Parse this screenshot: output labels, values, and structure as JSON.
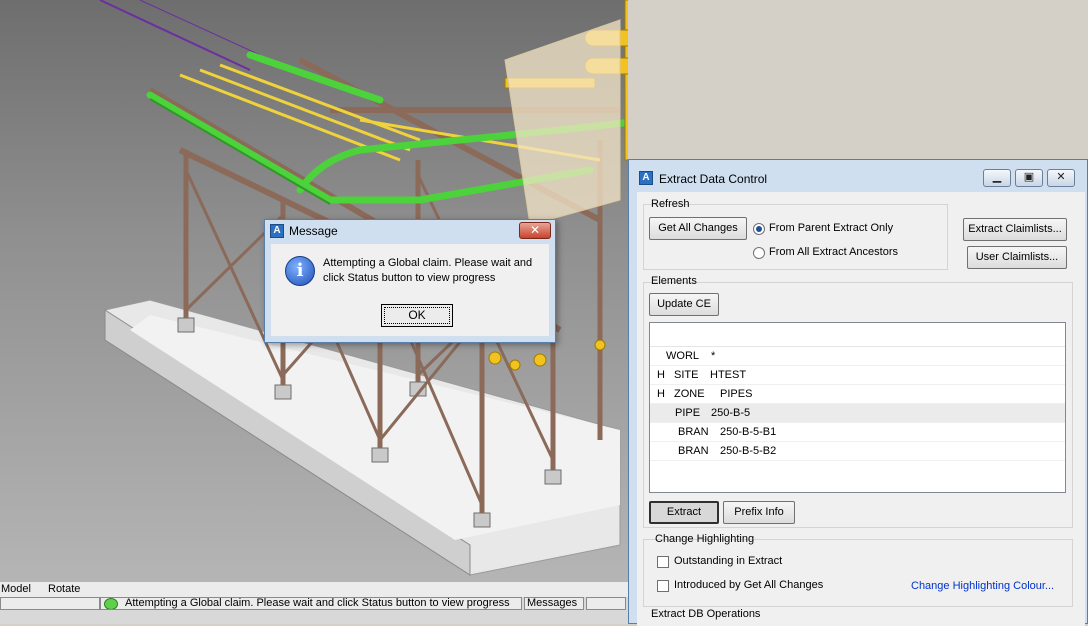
{
  "viewport": {
    "name": "3D model view"
  },
  "status": {
    "mode": "Model",
    "action": "Rotate",
    "message": "Attempting a Global claim. Please wait  and click Status button to view progress",
    "messages_button": "Messages"
  },
  "message_dialog": {
    "title": "Message",
    "close": "✕",
    "text": "Attempting a Global claim. Please wait and click Status button to view progress",
    "ok_label": "OK"
  },
  "extract_panel": {
    "title": "Extract Data Control",
    "refresh": {
      "label": "Refresh",
      "get_all_changes": "Get All Changes",
      "from_parent": "From Parent Extract Only",
      "from_all": "From All Extract Ancestors",
      "selected": "from_parent",
      "extract_claimlists": "Extract Claimlists...",
      "user_claimlists": "User Claimlists..."
    },
    "elements": {
      "label": "Elements",
      "update_ce": "Update CE",
      "rows": [
        {
          "flag": "",
          "type": "WORL",
          "name": "*",
          "indent": 0,
          "selected": false
        },
        {
          "flag": "H",
          "type": "SITE",
          "name": "HTEST",
          "indent": 0,
          "selected": false
        },
        {
          "flag": "H",
          "type": "ZONE",
          "name": "PIPES",
          "indent": 0,
          "selected": false
        },
        {
          "flag": "",
          "type": "PIPE",
          "name": "250-B-5",
          "indent": 1,
          "selected": true
        },
        {
          "flag": "",
          "type": "BRAN",
          "name": "250-B-5-B1",
          "indent": 2,
          "selected": false
        },
        {
          "flag": "",
          "type": "BRAN",
          "name": "250-B-5-B2",
          "indent": 2,
          "selected": false
        }
      ],
      "extract": "Extract",
      "prefix_info": "Prefix Info"
    },
    "change_highlighting": {
      "label": "Change Highlighting",
      "outstanding": "Outstanding in Extract",
      "introduced": "Introduced by Get All Changes",
      "colour_link": "Change Highlighting Colour..."
    },
    "db_operations": {
      "label": "Extract DB Operations"
    }
  },
  "colors": {
    "steel": "#8b6a5a",
    "green_pipe": "#4cd23a",
    "yellow_pipe": "#f0d23a",
    "title_bar": "#cfdff0"
  }
}
